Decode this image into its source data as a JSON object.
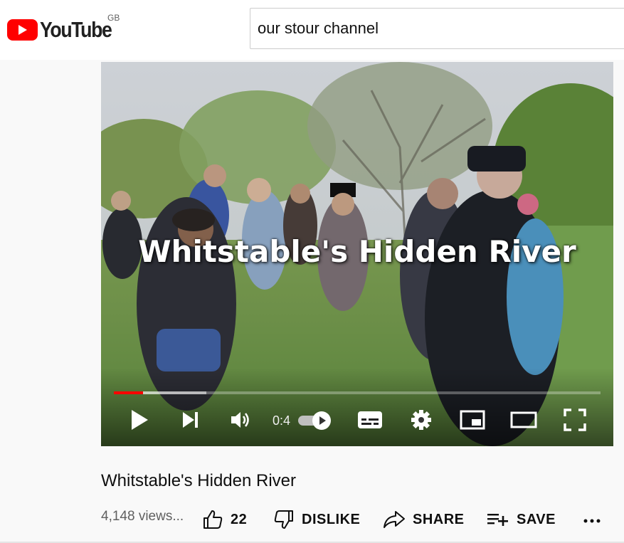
{
  "masthead": {
    "brand_name": "YouTube",
    "country_code": "GB",
    "search_query": "our stour channel"
  },
  "player": {
    "overlay_title": "Whitstable's Hidden River",
    "current_time": "0:4",
    "progress_played_fraction": 0.06,
    "progress_loaded_fraction": 0.19,
    "autoplay_on": true,
    "colors": {
      "played": "#ff0000"
    }
  },
  "video": {
    "title": "Whitstable's Hidden River",
    "views": "4,148 views...",
    "like_count": "22",
    "dislike_label": "DISLIKE",
    "share_label": "SHARE",
    "save_label": "SAVE"
  },
  "icons": {
    "logo": "youtube-logo-icon",
    "play": "play-icon",
    "next": "next-icon",
    "volume": "volume-icon",
    "autoplay": "autoplay-toggle",
    "subtitles": "subtitles-icon",
    "settings": "gear-icon",
    "miniplayer": "miniplayer-icon",
    "theater": "theater-mode-icon",
    "fullscreen": "fullscreen-icon",
    "like": "thumbs-up-icon",
    "dislike": "thumbs-down-icon",
    "share": "share-icon",
    "save": "playlist-add-icon",
    "more": "more-horizontal-icon"
  },
  "colors": {
    "brand": "#ff0000",
    "page_bg": "#f9f9f9",
    "text": "#0f0f0f",
    "secondary_text": "#606060"
  }
}
